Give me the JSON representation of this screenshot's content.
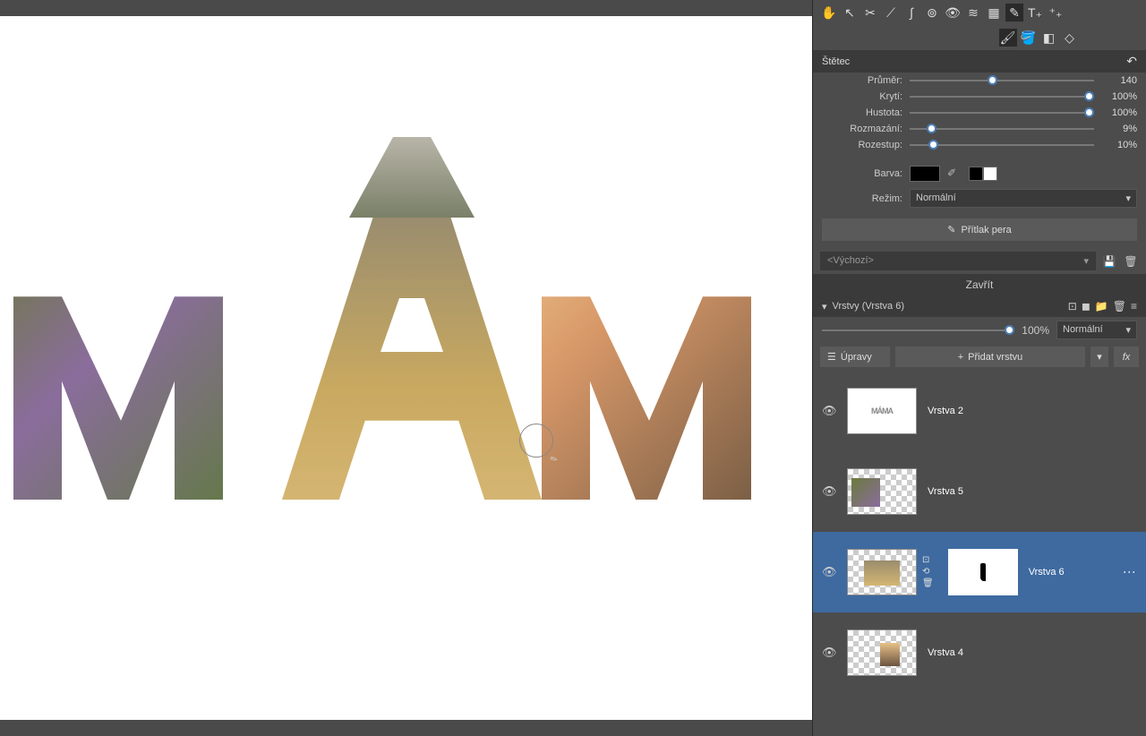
{
  "brush_panel": {
    "title": "Štětec",
    "sliders": {
      "diameter": {
        "label": "Průměr:",
        "value": "140",
        "pos": 42
      },
      "opacity": {
        "label": "Krytí:",
        "value": "100%",
        "pos": 100
      },
      "density": {
        "label": "Hustota:",
        "value": "100%",
        "pos": 100
      },
      "blur": {
        "label": "Rozmazání:",
        "value": "9%",
        "pos": 9
      },
      "spacing": {
        "label": "Rozestup:",
        "value": "10%",
        "pos": 10
      }
    },
    "color_label": "Barva:",
    "mode_label": "Režim:",
    "mode_value": "Normální",
    "pen_pressure": "Přítlak pera"
  },
  "preset": {
    "value": "<Výchozí>"
  },
  "close_label": "Zavřít",
  "layers_panel": {
    "title": "Vrstvy (Vrstva 6)",
    "opacity_value": "100%",
    "blend_mode": "Normální",
    "edit_btn": "Úpravy",
    "add_btn": "Přidat vrstvu",
    "fx": "fx",
    "layers": [
      {
        "name": "Vrstva 2"
      },
      {
        "name": "Vrstva 5"
      },
      {
        "name": "Vrstva 6"
      },
      {
        "name": "Vrstva 4"
      }
    ]
  }
}
